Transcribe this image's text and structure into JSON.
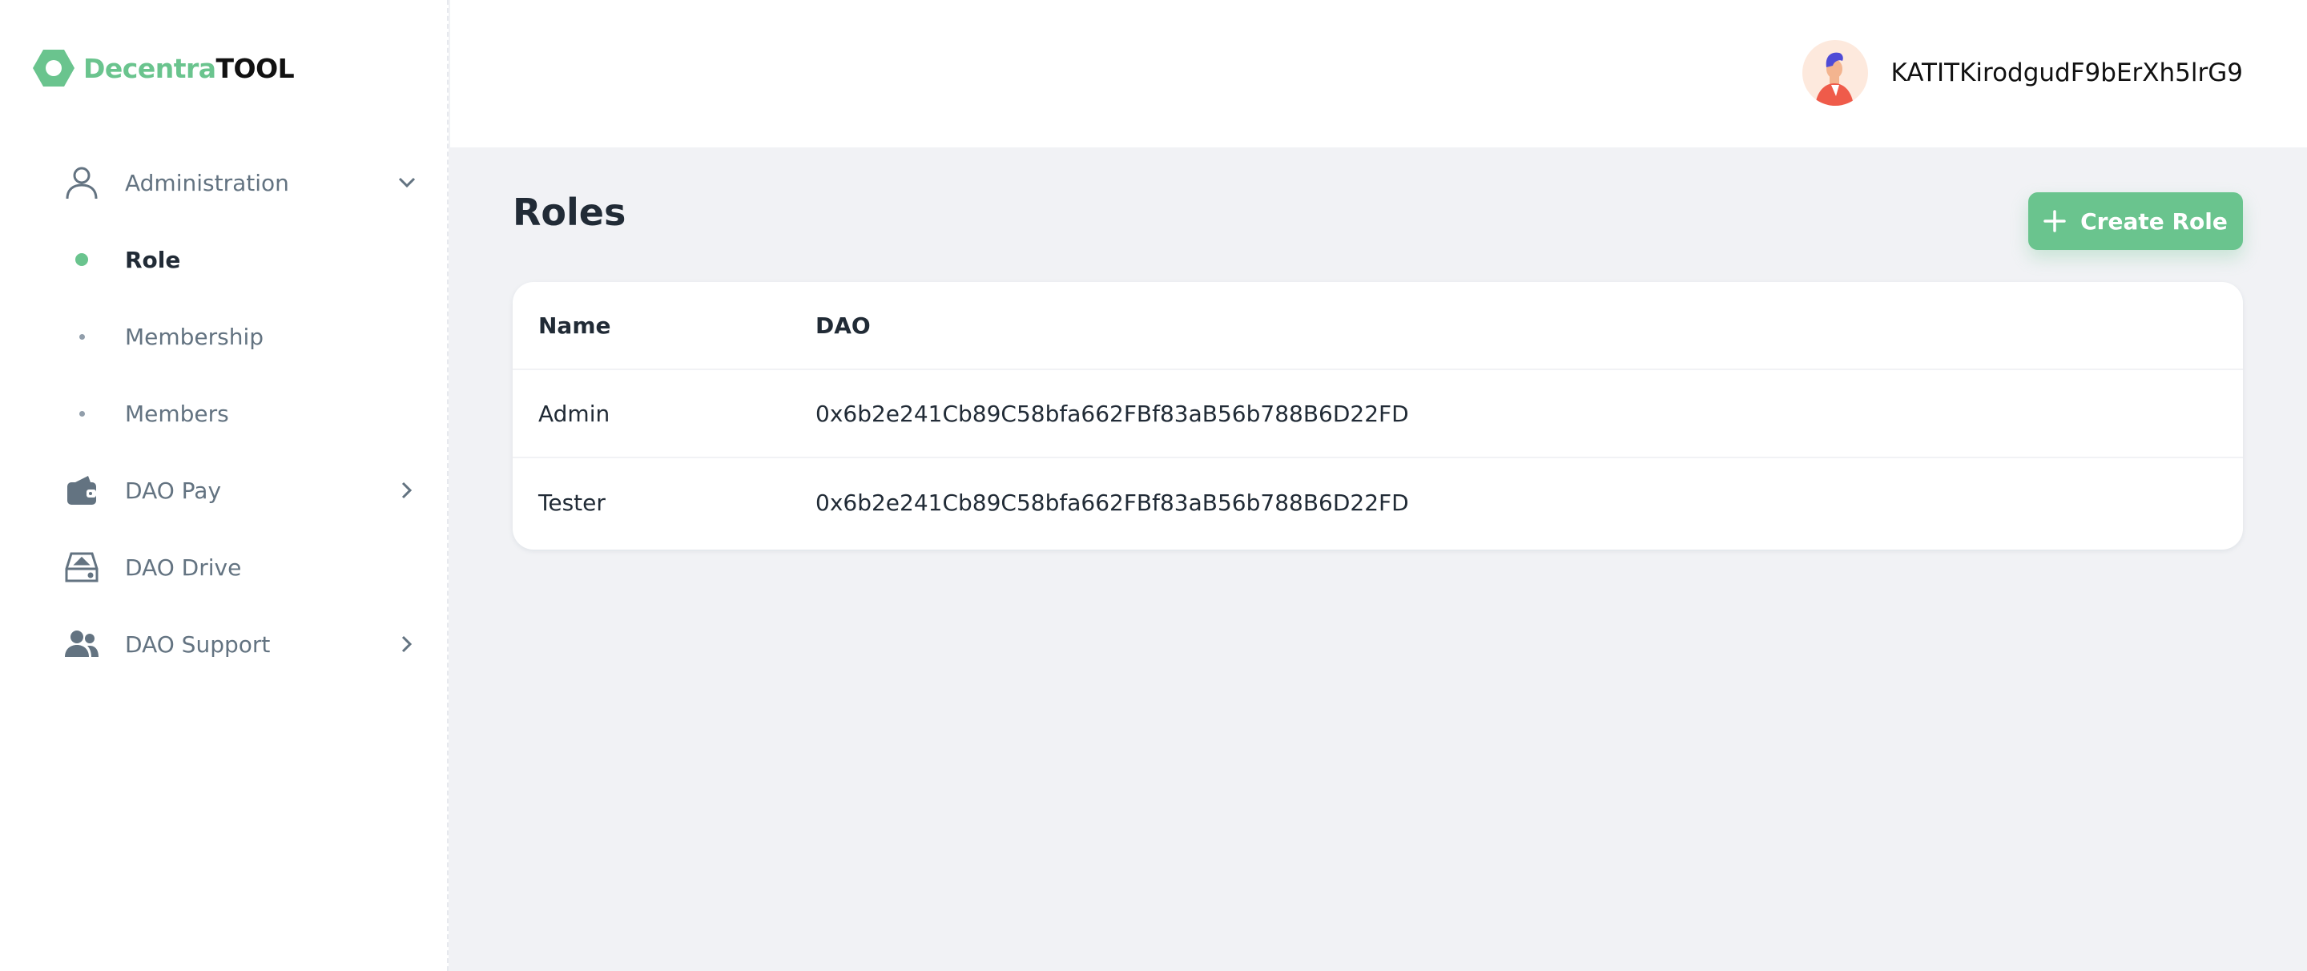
{
  "logo": {
    "part1": "Decentra",
    "part2": "TOOL"
  },
  "sidebar": {
    "items": [
      {
        "label": "Administration",
        "icon": "user-icon",
        "chevron": "down"
      },
      {
        "label": "Role",
        "active": true
      },
      {
        "label": "Membership"
      },
      {
        "label": "Members"
      },
      {
        "label": "DAO Pay",
        "icon": "wallet-icon",
        "chevron": "right"
      },
      {
        "label": "DAO Drive",
        "icon": "drive-icon"
      },
      {
        "label": "DAO Support",
        "icon": "users-icon",
        "chevron": "right"
      }
    ]
  },
  "header": {
    "username": "KATITKirodgudF9bErXh5lrG9"
  },
  "main": {
    "title": "Roles",
    "create_button": "Create Role",
    "table": {
      "columns": [
        "Name",
        "DAO"
      ],
      "rows": [
        [
          "Admin",
          "0x6b2e241Cb89C58bfa662FBf83aB56b788B6D22FD"
        ],
        [
          "Tester",
          "0x6b2e241Cb89C58bfa662FBf83aB56b788B6D22FD"
        ]
      ]
    }
  },
  "colors": {
    "accent": "#6ac48e",
    "text": "#212b36",
    "muted": "#637381",
    "bg": "#f1f2f5"
  }
}
